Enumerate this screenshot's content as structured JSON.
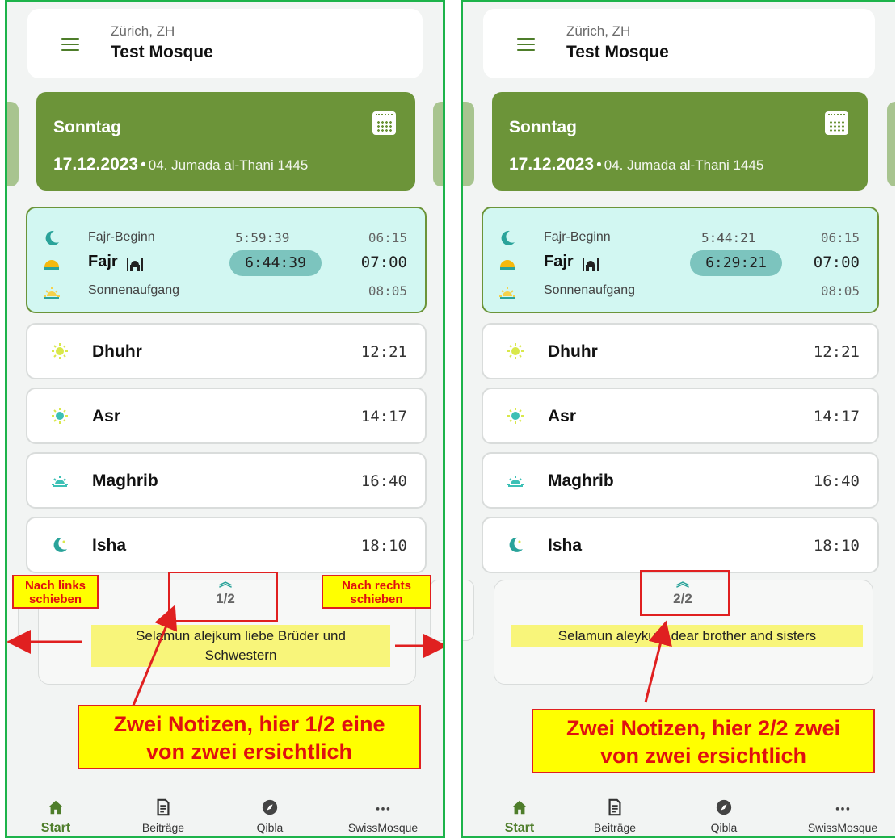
{
  "colors": {
    "frame": "#1db34a",
    "accent_green": "#6c9439",
    "fajr_bg": "#d2f7f2",
    "countdown_bg": "#7cc4be",
    "highlight": "#f8f57a",
    "annotation_red": "#e02020",
    "annotation_yellow": "#ffff00"
  },
  "panels": [
    {
      "location": {
        "city": "Zürich, ZH",
        "mosque": "Test Mosque"
      },
      "date": {
        "day": "Sonntag",
        "gregorian": "17.12.2023",
        "separator": "•",
        "hijri": "04. Jumada al-Thani 1445"
      },
      "fajr": {
        "begin_label": "Fajr-Beginn",
        "begin_countdown": "5:59:39",
        "begin_time": "06:15",
        "label": "Fajr",
        "countdown": "6:44:39",
        "time": "07:00",
        "sunrise_label": "Sonnenaufgang",
        "sunrise_time": "08:05"
      },
      "prayers": [
        {
          "name": "Dhuhr",
          "time": "12:21",
          "icon": "sun-icon"
        },
        {
          "name": "Asr",
          "time": "14:17",
          "icon": "sun-icon"
        },
        {
          "name": "Maghrib",
          "time": "16:40",
          "icon": "sunset-icon"
        },
        {
          "name": "Isha",
          "time": "18:10",
          "icon": "crescent-icon"
        }
      ],
      "note": {
        "pager": "1/2",
        "text_line1": "Selamun alejkum liebe Brüder und",
        "text_line2": "Schwestern"
      },
      "annotations": {
        "swipe_left": "Nach links schieben",
        "swipe_left_l1": "Nach links",
        "swipe_left_l2": "schieben",
        "swipe_right_l1": "Nach rechts",
        "swipe_right_l2": "schieben",
        "callout_l1": "Zwei Notizen, hier 1/2 eine",
        "callout_l2": "von zwei ersichtlich"
      }
    },
    {
      "location": {
        "city": "Zürich, ZH",
        "mosque": "Test Mosque"
      },
      "date": {
        "day": "Sonntag",
        "gregorian": "17.12.2023",
        "separator": "•",
        "hijri": "04. Jumada al-Thani 1445"
      },
      "fajr": {
        "begin_label": "Fajr-Beginn",
        "begin_countdown": "5:44:21",
        "begin_time": "06:15",
        "label": "Fajr",
        "countdown": "6:29:21",
        "time": "07:00",
        "sunrise_label": "Sonnenaufgang",
        "sunrise_time": "08:05"
      },
      "prayers": [
        {
          "name": "Dhuhr",
          "time": "12:21",
          "icon": "sun-icon"
        },
        {
          "name": "Asr",
          "time": "14:17",
          "icon": "sun-icon"
        },
        {
          "name": "Maghrib",
          "time": "16:40",
          "icon": "sunset-icon"
        },
        {
          "name": "Isha",
          "time": "18:10",
          "icon": "crescent-icon"
        }
      ],
      "note": {
        "pager": "2/2",
        "text": "Selamun aleykum dear brother and sisters"
      },
      "annotations": {
        "callout_l1": "Zwei Notizen, hier 2/2 zwei",
        "callout_l2": "von zwei ersichtlich"
      }
    }
  ],
  "bottom_nav": [
    {
      "label": "Start",
      "icon": "home-icon",
      "active": true
    },
    {
      "label": "Beiträge",
      "icon": "document-icon",
      "active": false
    },
    {
      "label": "Qibla",
      "icon": "compass-icon",
      "active": false
    },
    {
      "label": "SwissMosque",
      "icon": "more-icon",
      "active": false
    }
  ]
}
